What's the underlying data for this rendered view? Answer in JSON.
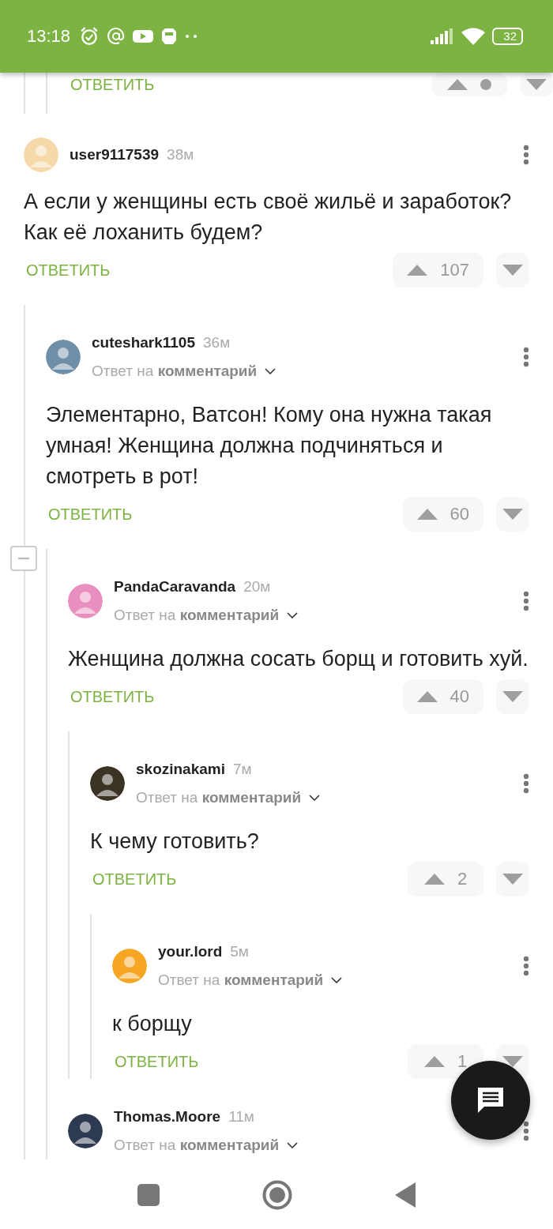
{
  "status_bar": {
    "time": "13:18",
    "battery": "32"
  },
  "previous_footer": {
    "reply_label": "ОТВЕТИТЬ"
  },
  "comments": [
    {
      "author": "user9117539",
      "time": "38м",
      "color": "#f6d9a8",
      "text": "А если у женщины есть своё жильё и заработок? Как её лоханить будем?",
      "reply_label": "ОТВЕТИТЬ",
      "score": "107",
      "children": [
        {
          "author": "cuteshark1105",
          "time": "36м",
          "color": "#6f8fa8",
          "reply_to": "Ответ на **комментарий**",
          "text": "Элементарно, Ватсон! Кому она нужна такая умная! Женщина должна подчиняться и смотреть в рот!",
          "reply_label": "ОТВЕТИТЬ",
          "score": "60",
          "collapsed": false,
          "children": [
            {
              "author": "PandaCaravanda",
              "time": "20м",
              "color": "#e98fc0",
              "reply_to": "Ответ на **комментарий**",
              "text": "Женщина должна сосать борщ и готовить хуй.",
              "reply_label": "ОТВЕТИТЬ",
              "score": "40",
              "children": [
                {
                  "author": "skozinakami",
                  "time": "7м",
                  "color": "#3b3324",
                  "reply_to": "Ответ на **комментарий**",
                  "text": "К чему готовить?",
                  "reply_label": "ОТВЕТИТЬ",
                  "score": "2",
                  "children": [
                    {
                      "author": "your.lord",
                      "time": "5м",
                      "color": "#f6a623",
                      "reply_to": "Ответ на **комментарий**",
                      "text": "к борщу",
                      "reply_label": "ОТВЕТИТЬ",
                      "score": "1"
                    }
                  ]
                }
              ]
            },
            {
              "author": "Thomas.Moore",
              "time": "11м",
              "color": "#2d3a52",
              "reply_to": "Ответ на **комментарий**"
            }
          ]
        }
      ]
    }
  ]
}
